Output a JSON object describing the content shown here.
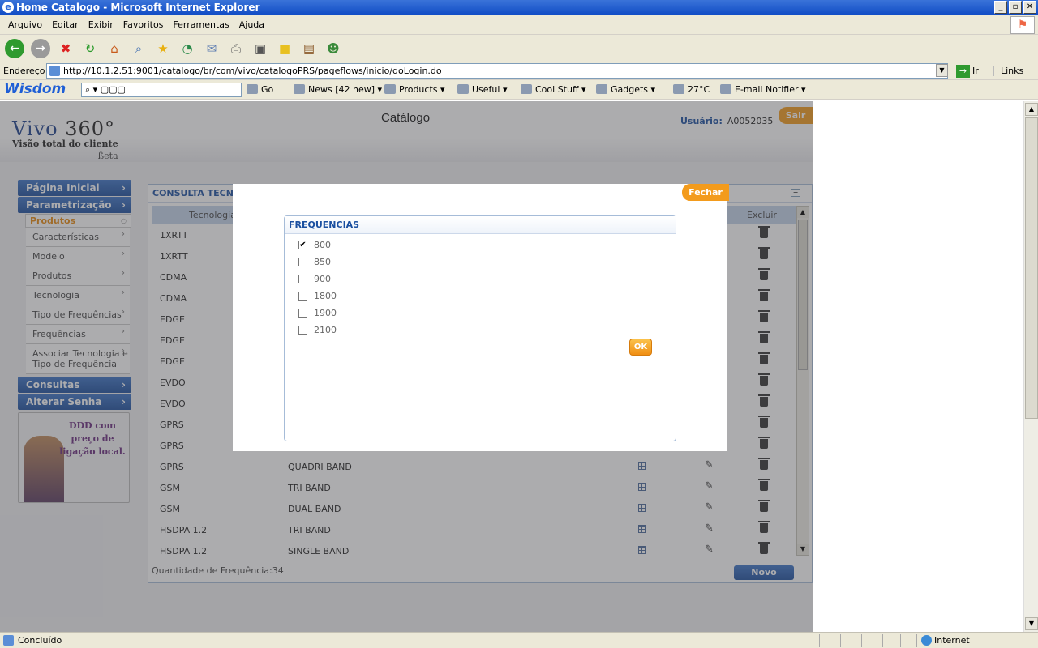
{
  "window": {
    "title": "Home Catalogo - Microsoft Internet Explorer"
  },
  "menu": [
    "Arquivo",
    "Editar",
    "Exibir",
    "Favoritos",
    "Ferramentas",
    "Ajuda"
  ],
  "address": {
    "label": "Endereço",
    "url": "http://10.1.2.51:9001/catalogo/br/com/vivo/catalogoPRS/pageflows/inicio/doLogin.do",
    "go": "Ir",
    "links": "Links"
  },
  "wisdom": {
    "brand": "Wisdom",
    "search": "▢▢▢",
    "go": "Go",
    "news": "News [42 new]",
    "products": "Products",
    "useful": "Useful",
    "cool": "Cool Stuff",
    "gadgets": "Gadgets",
    "temp": "27°C",
    "email": "E-mail Notifier"
  },
  "header": {
    "logo_main": "Vivo",
    "logo_num": "360°",
    "logo_sub": "Visão total do cliente",
    "logo_beta": "ßeta",
    "title": "Catálogo",
    "user_label": "Usuário:",
    "user_id": "A0052035",
    "logout": "Sair"
  },
  "sidebar": {
    "top": [
      {
        "label": "Página Inicial"
      },
      {
        "label": "Parametrização"
      }
    ],
    "sub": "Produtos",
    "subitems": [
      {
        "label": "Características"
      },
      {
        "label": "Modelo"
      },
      {
        "label": "Produtos"
      },
      {
        "label": "Tecnologia"
      },
      {
        "label": "Tipo de Frequências"
      },
      {
        "label": "Frequências"
      },
      {
        "label": "Associar Tecnologia e Tipo de Frequência"
      }
    ],
    "bottom": [
      {
        "label": "Consultas"
      },
      {
        "label": "Alterar Senha"
      }
    ],
    "promo": "DDD com preço de ligação local."
  },
  "main": {
    "title": "CONSULTA TECNOLOGIA",
    "col_tech": "Tecnologia",
    "col_delete": "Excluir",
    "rows": [
      {
        "tech": "1XRTT",
        "type": ""
      },
      {
        "tech": "1XRTT",
        "type": ""
      },
      {
        "tech": "CDMA",
        "type": ""
      },
      {
        "tech": "CDMA",
        "type": ""
      },
      {
        "tech": "EDGE",
        "type": ""
      },
      {
        "tech": "EDGE",
        "type": ""
      },
      {
        "tech": "EDGE",
        "type": ""
      },
      {
        "tech": "EVDO",
        "type": ""
      },
      {
        "tech": "EVDO",
        "type": ""
      },
      {
        "tech": "GPRS",
        "type": ""
      },
      {
        "tech": "GPRS",
        "type": ""
      },
      {
        "tech": "GPRS",
        "type": "QUADRI BAND"
      },
      {
        "tech": "GSM",
        "type": "TRI BAND"
      },
      {
        "tech": "GSM",
        "type": "DUAL BAND"
      },
      {
        "tech": "HSDPA 1.2",
        "type": "TRI BAND"
      },
      {
        "tech": "HSDPA 1.2",
        "type": "SINGLE BAND"
      }
    ],
    "count": "Quantidade de Frequência:34",
    "new_button": "Novo"
  },
  "modal": {
    "close": "Fechar",
    "title": "FREQUENCIAS",
    "options": [
      {
        "label": "800",
        "checked": true
      },
      {
        "label": "850",
        "checked": false
      },
      {
        "label": "900",
        "checked": false
      },
      {
        "label": "1800",
        "checked": false
      },
      {
        "label": "1900",
        "checked": false
      },
      {
        "label": "2100",
        "checked": false
      }
    ],
    "ok": "OK"
  },
  "status": {
    "text": "Concluído",
    "zone": "Internet"
  }
}
